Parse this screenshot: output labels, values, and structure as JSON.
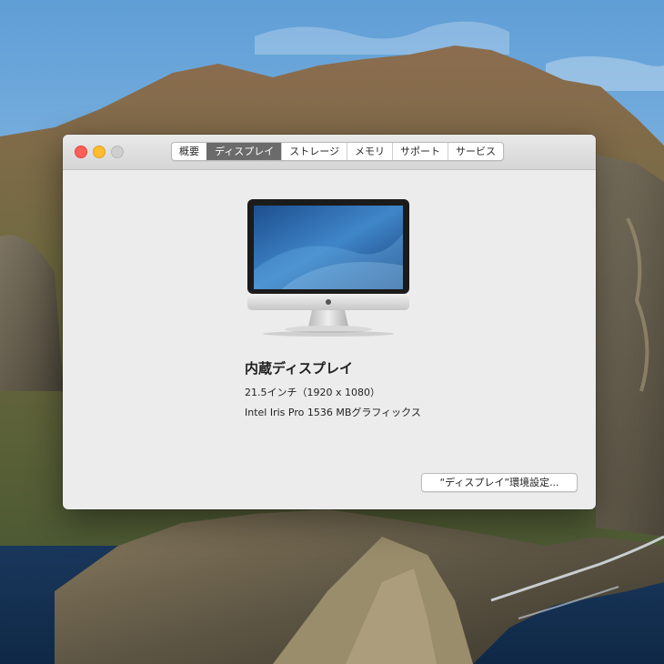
{
  "tabs": [
    {
      "label": "概要"
    },
    {
      "label": "ディスプレイ"
    },
    {
      "label": "ストレージ"
    },
    {
      "label": "メモリ"
    },
    {
      "label": "サポート"
    },
    {
      "label": "サービス"
    }
  ],
  "active_tab": "ディスプレイ",
  "display": {
    "title": "内蔵ディスプレイ",
    "size_resolution": "21.5インチ（1920 x 1080）",
    "graphics": "Intel Iris Pro 1536 MBグラフィックス"
  },
  "button": {
    "label": "“ディスプレイ”環境設定..."
  },
  "colors": {
    "close": "#fe5f57",
    "minimize": "#febc2e",
    "zoom_disabled": "#cfcfcf",
    "tab_active_bg": "#6b6b6b",
    "window_bg": "#ececec"
  }
}
